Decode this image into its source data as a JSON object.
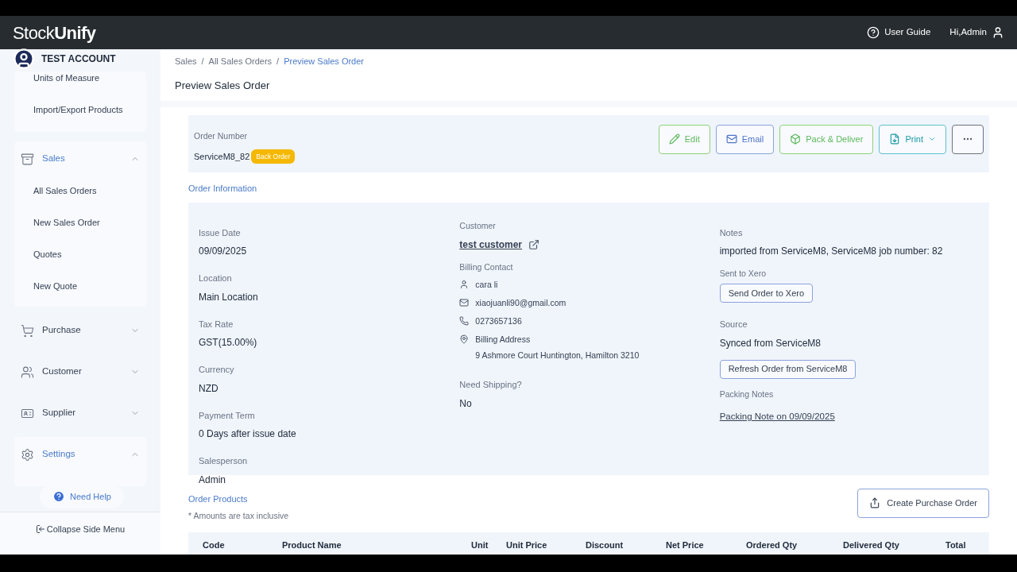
{
  "header": {
    "logo": {
      "plain": "Stock",
      "accent": "Unify"
    },
    "user_guide": "User Guide",
    "greeting": "Hi,Admin"
  },
  "sidebar": {
    "account": "TEST ACCOUNT",
    "scrolled_items": [
      "Units of Measure",
      "Import/Export Products"
    ],
    "groups": [
      {
        "kind": "sales",
        "label": "Sales",
        "expanded": true,
        "children": [
          "All Sales Orders",
          "New Sales Order",
          "Quotes",
          "New Quote"
        ]
      },
      {
        "kind": "purchase",
        "label": "Purchase",
        "expanded": false
      },
      {
        "kind": "customer",
        "label": "Customer",
        "expanded": false
      },
      {
        "kind": "supplier",
        "label": "Supplier",
        "expanded": false
      },
      {
        "kind": "settings",
        "label": "Settings",
        "expanded": true
      }
    ],
    "help": "Need Help",
    "collapse": "Collapse Side Menu"
  },
  "breadcrumb_separator": "/",
  "breadcrumbs": [
    {
      "label": "Sales",
      "selected": false
    },
    {
      "label": "All Sales Orders",
      "selected": false
    },
    {
      "label": "Preview Sales Order",
      "selected": true
    }
  ],
  "title": "Preview Sales Order",
  "order": {
    "label": "Order Number",
    "number": "ServiceM8_82",
    "badge": "Back Order"
  },
  "actions": [
    {
      "kind": "edit",
      "label": "Edit"
    },
    {
      "kind": "email",
      "label": "Email"
    },
    {
      "kind": "pack",
      "label": "Pack & Deliver"
    },
    {
      "kind": "print",
      "label": "Print"
    },
    {
      "kind": "more"
    }
  ],
  "order_information": {
    "heading": "Order Information",
    "fields": [
      {
        "label": "Issue Date",
        "value": "09/09/2025"
      },
      {
        "label": "Location",
        "value": "Main Location"
      },
      {
        "label": "Tax Rate",
        "value": "GST(15.00%)"
      },
      {
        "label": "Currency",
        "value": "NZD"
      },
      {
        "label": "Payment Term",
        "value": "0 Days after issue date"
      },
      {
        "label": "Salesperson",
        "value": "Admin"
      }
    ],
    "customer": {
      "label": "Customer",
      "name": "test customer"
    },
    "billing_contact": {
      "label": "Billing Contact",
      "lines": [
        {
          "kind": "person",
          "text": "cara li"
        },
        {
          "kind": "email",
          "text": "xiaojuanli90@gmail.com"
        },
        {
          "kind": "phone",
          "text": "0273657136"
        },
        {
          "kind": "address",
          "text": "Billing Address",
          "detail": "9 Ashmore Court Huntington, Hamilton 3210"
        }
      ]
    },
    "shipping": {
      "label": "Need Shipping?",
      "value": "No"
    },
    "notes": {
      "label": "Notes",
      "value": "imported from ServiceM8, ServiceM8 job number: 82"
    },
    "xero": {
      "label": "Sent to Xero",
      "button": "Send Order to Xero"
    },
    "source": {
      "label": "Source",
      "value": "Synced from ServiceM8",
      "button": "Refresh Order from ServiceM8"
    },
    "packing": {
      "label": "Packing Notes",
      "link": "Packing Note on 09/09/2025"
    }
  },
  "order_products": {
    "heading": "Order Products",
    "note": "* Amounts are tax inclusive",
    "button": "Create Purchase Order",
    "columns": [
      "Code",
      "Product Name",
      "Unit",
      "Unit Price",
      "Discount",
      "Net Price",
      "Ordered Qty",
      "Delivered Qty",
      "Total"
    ]
  }
}
